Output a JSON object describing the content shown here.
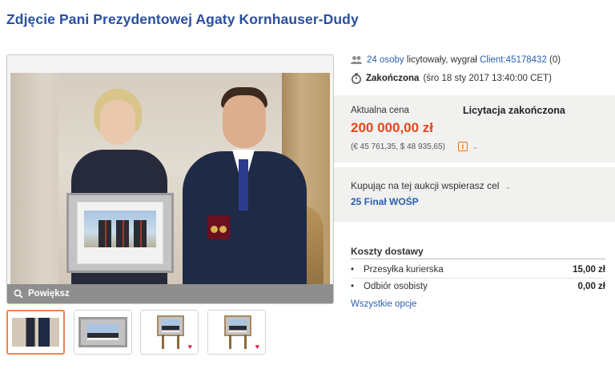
{
  "title": "Zdjęcie Pani Prezydentowej Agaty Kornhauser-Dudy",
  "photo": {
    "zoom_label": "Powiększ"
  },
  "thumbnails": [
    {
      "name": "thumb-1",
      "active": true
    },
    {
      "name": "thumb-2",
      "active": false
    },
    {
      "name": "thumb-3",
      "active": false,
      "favorite": true
    },
    {
      "name": "thumb-4",
      "active": false,
      "favorite": true
    }
  ],
  "bidders": {
    "count_link": "24 osoby",
    "text": "licytowały, wygrał",
    "winner_link": "Client:45178432",
    "winner_score": "(0)"
  },
  "status": {
    "label": "Zakończona",
    "date": "(śro 18 sty 2017 13:40:00 CET)"
  },
  "price": {
    "label": "Aktualna cena",
    "auction_state": "Licytacja zakończona",
    "amount": "200 000,00 zł",
    "conversion": "(€ 45 761,35, $ 48 935,65)"
  },
  "charity": {
    "label": "Kupując na tej aukcji wspierasz cel",
    "name": "25 Finał WOŚP"
  },
  "shipping": {
    "title": "Koszty dostawy",
    "options": [
      {
        "name": "Przesyłka kurierska",
        "price": "15,00 zł"
      },
      {
        "name": "Odbiór osobisty",
        "price": "0,00 zł"
      }
    ],
    "all_options": "Wszystkie opcje"
  },
  "colors": {
    "link": "#2a5fb0",
    "price": "#e8461b",
    "title": "#2a4f9e",
    "active_thumb_border": "#e8884b"
  }
}
